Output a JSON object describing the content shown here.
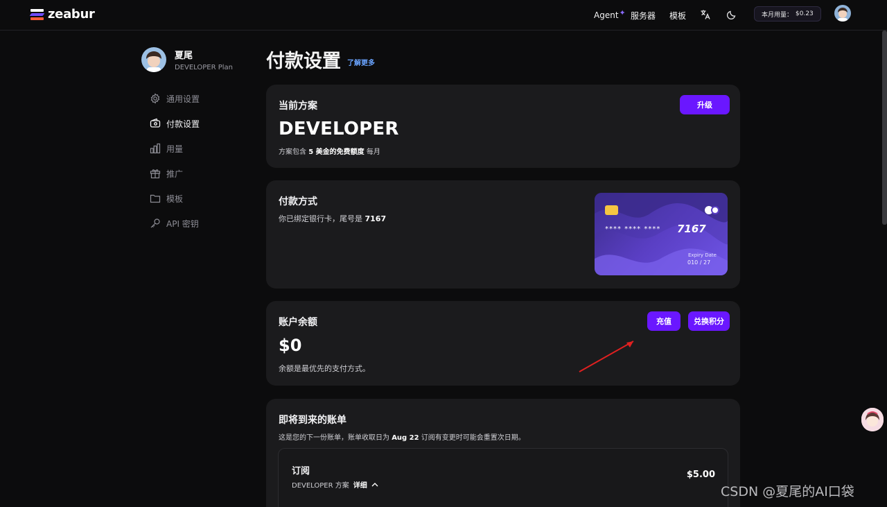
{
  "header": {
    "brand": "zeabur",
    "nav": {
      "agent": "Agent",
      "servers": "服务器",
      "templates": "模板"
    },
    "usage_label": "本月用量：",
    "usage_value": "$0.23"
  },
  "sidebar": {
    "user_name": "夏尾",
    "user_plan": "DEVELOPER Plan",
    "items": [
      {
        "label": "通用设置",
        "icon": "gear-icon"
      },
      {
        "label": "付款设置",
        "icon": "wallet-icon"
      },
      {
        "label": "用量",
        "icon": "bar-chart-icon"
      },
      {
        "label": "推广",
        "icon": "gift-icon"
      },
      {
        "label": "模板",
        "icon": "folder-icon"
      },
      {
        "label": "API 密钥",
        "icon": "key-icon"
      }
    ],
    "active_index": 1
  },
  "page": {
    "title": "付款设置",
    "learn_more": "了解更多"
  },
  "plan_card": {
    "heading": "当前方案",
    "upgrade": "升级",
    "plan_name": "DEVELOPER",
    "note_prefix": "方案包含",
    "note_bold": "5 美金的免费额度",
    "note_suffix": "每月"
  },
  "payment_card": {
    "heading": "付款方式",
    "note_prefix": "你已绑定银行卡，尾号是",
    "last4": "7167",
    "masked": "**** **** ****",
    "expiry_label": "Expiry Date",
    "expiry": "010 / 27",
    "accent": "#5a3fc4"
  },
  "balance_card": {
    "heading": "账户余额",
    "recharge": "充值",
    "redeem": "兑换积分",
    "amount": "$0",
    "note": "余额是最优先的支付方式。"
  },
  "bill_card": {
    "heading": "即将到来的账单",
    "note_prefix": "这是您的下一份账单，账单收取日为",
    "date": "Aug 22",
    "note_suffix": "订阅有变更时可能会重置次日期。",
    "sub_title": "订阅",
    "sub_plan": "DEVELOPER 方案",
    "details": "详细",
    "price": "$5.00"
  },
  "watermark": "CSDN @夏尾的AI口袋",
  "colors": {
    "primary": "#6a17ff",
    "link": "#6aa4ff"
  }
}
